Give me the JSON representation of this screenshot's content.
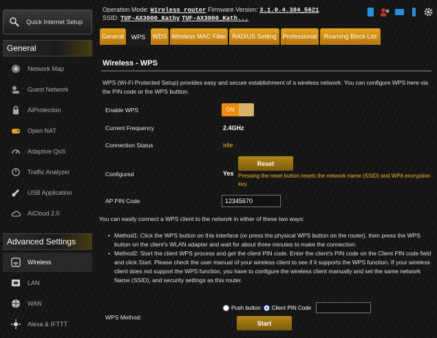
{
  "sidebar": {
    "quick_setup": "Quick Internet Setup",
    "general_heading": "General",
    "general_items": [
      "Network Map",
      "Guest Network",
      "AiProtection",
      "Open NAT",
      "Adaptive QoS",
      "Traffic Analyzer",
      "USB Application",
      "AiCloud 2.0"
    ],
    "advanced_heading": "Advanced Settings",
    "advanced_items": [
      "Wireless",
      "LAN",
      "WAN",
      "Alexa & IFTTT"
    ]
  },
  "header": {
    "opmode_label": "Operation Mode:",
    "opmode_value": "Wireless router",
    "fw_label": "Firmware Version:",
    "fw_value": "3.1.0.4.384_5621",
    "ssid_label": "SSID:",
    "ssid_1": "TUF-AX3000_Kathy",
    "ssid_2": "TUF-AX3000_Kath..."
  },
  "tabs": [
    "General",
    "WPS",
    "WDS",
    "Wireless MAC Filter",
    "RADIUS Setting",
    "Professional",
    "Roaming Block List"
  ],
  "main": {
    "title": "Wireless - WPS",
    "description": "WPS (Wi-Fi Protected Setup) provides easy and secure establishment of a wireless network. You can configure WPS here via the PIN code or the WPS buttton.",
    "enable_wps_label": "Enable WPS",
    "enable_wps_state": "ON",
    "freq_label": "Current Frequency",
    "freq_value": "2.4GHz",
    "conn_label": "Connection Status",
    "conn_value": "Idle",
    "configured_label": "Configured",
    "configured_value": "Yes",
    "reset_button": "Reset",
    "reset_note": "Pressing the reset button resets the network name (SSID) and WPA encryption key.",
    "pin_label": "AP PIN Code",
    "pin_value": "12345670",
    "connect_intro": "You can easily connect a WPS client to the network in either of these two ways:",
    "method1": "Method1: Click the WPS button on this interface (or press the physical WPS button on the router), then press the WPS button on the client's WLAN adapter and wait for about three minutes to make the connection.",
    "method2": "Method2: Start the client WPS process and get the client PIN code. Enter the client's PIN code on the Client PIN code field and click Start. Please check the user manual of your wireless client to see if it supports the WPS function. If your wireless client does not support the WPS function, you have to configure the wireless client manually and set the same network Name (SSID), and security settings as this router.",
    "wps_method_label": "WPS Method:",
    "push_button_label": "Push button",
    "client_pin_label": "Client PIN Code",
    "client_pin_value": "",
    "start_button": "Start"
  },
  "colors": {
    "accent": "#f08a0c",
    "tab": "#d8951a",
    "status": "#f0b429"
  }
}
